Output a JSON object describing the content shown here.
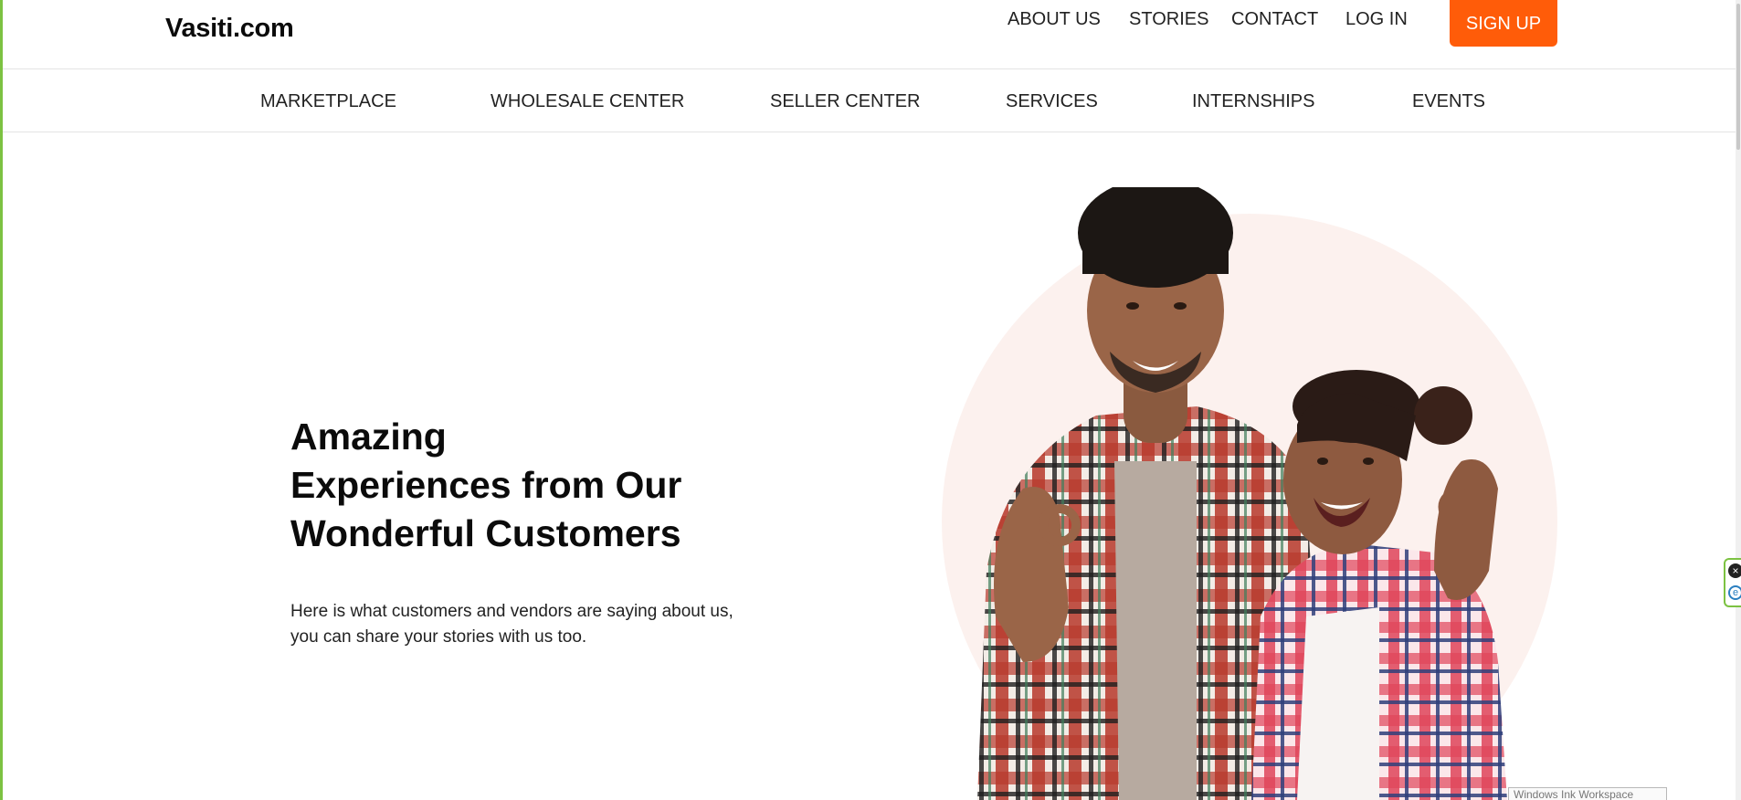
{
  "header": {
    "logo": "Vasiti.com",
    "links": [
      "ABOUT US",
      "STORIES",
      "CONTACT",
      "LOG IN"
    ],
    "signup_label": "SIGN UP"
  },
  "subnav": {
    "items": [
      "MARKETPLACE",
      "WHOLESALE CENTER",
      "SELLER CENTER",
      "SERVICES",
      "INTERNSHIPS",
      "EVENTS"
    ]
  },
  "hero": {
    "title_lines": [
      "Amazing",
      "Experiences from Our",
      "Wonderful Customers"
    ],
    "subtitle": "Here is what customers and vendors are saying about us, you can share your stories with us too.",
    "image": "smiling-couple-plaid-shirts-ok-gesture"
  },
  "overlay": {
    "ink_workspace_label": "Windows Ink Workspace"
  },
  "colors": {
    "accent": "#ff5c09",
    "circle_bg": "#fcf1ee",
    "edge": "#7cc242"
  }
}
